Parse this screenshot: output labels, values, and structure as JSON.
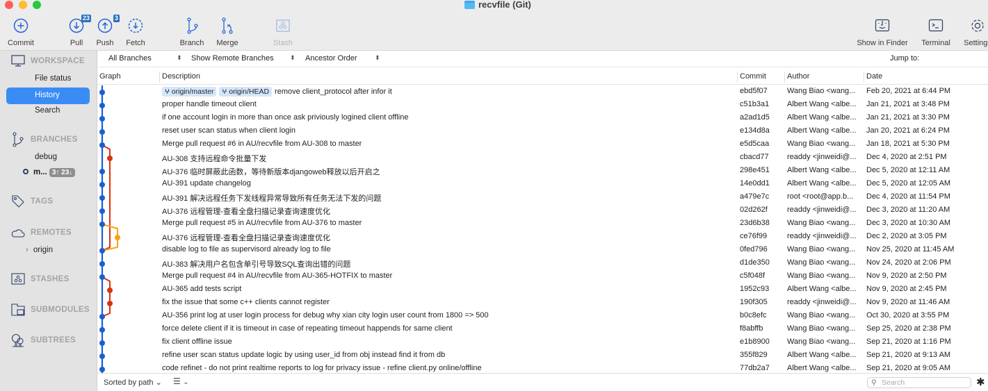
{
  "window": {
    "title": "recvfile (Git)"
  },
  "toolbar": {
    "commit": "Commit",
    "pull": "Pull",
    "pull_badge": "23",
    "push": "Push",
    "push_badge": "3",
    "fetch": "Fetch",
    "branch": "Branch",
    "merge": "Merge",
    "stash": "Stash",
    "show_in_finder": "Show in Finder",
    "terminal": "Terminal",
    "settings": "Settings"
  },
  "sidebar": {
    "workspace": "WORKSPACE",
    "file_status": "File status",
    "history": "History",
    "search": "Search",
    "branches": "BRANCHES",
    "branch_debug": "debug",
    "branch_current": "m...",
    "branch_current_badge": "3↑ 23↓",
    "tags": "TAGS",
    "remotes": "REMOTES",
    "remote_origin": "origin",
    "stashes": "STASHES",
    "submodules": "SUBMODULES",
    "subtrees": "SUBTREES"
  },
  "filters": {
    "branches": "All Branches",
    "remote": "Show Remote Branches",
    "order": "Ancestor Order",
    "jump_to": "Jump to:"
  },
  "columns": {
    "graph": "Graph",
    "description": "Description",
    "commit": "Commit",
    "author": "Author",
    "date": "Date"
  },
  "colors": {
    "main_line": "#1a5fd0",
    "branch_red": "#d9330f",
    "branch_orange": "#f5a318",
    "accent": "#3a8cf5"
  },
  "commits": [
    {
      "tags": [
        "origin/master",
        "origin/HEAD"
      ],
      "desc": "remove client_protocol after infor it",
      "hash": "ebd5f07",
      "author": "Wang Biao <wang...",
      "date": "Feb 20, 2021 at 6:44 PM"
    },
    {
      "tags": [],
      "desc": "proper handle timeout client",
      "hash": "c51b3a1",
      "author": "Albert Wang <albe...",
      "date": "Jan 21, 2021 at 3:48 PM"
    },
    {
      "tags": [],
      "desc": "if one account login in more than once ask priviously logined client offline",
      "hash": "a2ad1d5",
      "author": "Albert Wang <albe...",
      "date": "Jan 21, 2021 at 3:30 PM"
    },
    {
      "tags": [],
      "desc": "reset user scan status when client login",
      "hash": "e134d8a",
      "author": "Albert Wang <albe...",
      "date": "Jan 20, 2021 at 6:24 PM"
    },
    {
      "tags": [],
      "desc": "Merge pull request #6 in AU/recvfile from AU-308 to master",
      "hash": "e5d5caa",
      "author": "Wang Biao <wang...",
      "date": "Jan 18, 2021 at 5:30 PM"
    },
    {
      "tags": [],
      "desc": "AU-308 支持远程命令批量下发",
      "hash": "cbacd77",
      "author": "readdy <jinweidi@...",
      "date": "Dec 4, 2020 at 2:51 PM"
    },
    {
      "tags": [],
      "desc": "AU-376 临时屏蔽此函数，等待新版本djangoweb释放以后开启之",
      "hash": "298e451",
      "author": "Albert Wang <albe...",
      "date": "Dec 5, 2020 at 12:11 AM"
    },
    {
      "tags": [],
      "desc": "AU-391 update changelog",
      "hash": "14e0dd1",
      "author": "Albert Wang <albe...",
      "date": "Dec 5, 2020 at 12:05 AM"
    },
    {
      "tags": [],
      "desc": "AU-391 解决远程任务下发线程异常导致所有任务无法下发的问题",
      "hash": "a479e7c",
      "author": "root <root@app.b...",
      "date": "Dec 4, 2020 at 11:54 PM"
    },
    {
      "tags": [],
      "desc": "AU-376 远程管理-查看全盘扫描记录查询速度优化",
      "hash": "02d262f",
      "author": "readdy <jinweidi@...",
      "date": "Dec 3, 2020 at 11:20 AM"
    },
    {
      "tags": [],
      "desc": "Merge pull request #5 in AU/recvfile from AU-376 to master",
      "hash": "23d6b38",
      "author": "Wang Biao <wang...",
      "date": "Dec 3, 2020 at 10:30 AM"
    },
    {
      "tags": [],
      "desc": "AU-376 远程管理-查看全盘扫描记录查询速度优化",
      "hash": "ce76f99",
      "author": "readdy <jinweidi@...",
      "date": "Dec 2, 2020 at 3:05 PM"
    },
    {
      "tags": [],
      "desc": "disable log to file as supervisord already log to file",
      "hash": "0fed796",
      "author": "Wang Biao <wang...",
      "date": "Nov 25, 2020 at 11:45 AM"
    },
    {
      "tags": [],
      "desc": "AU-383 解决用户名包含单引号导致SQL查询出错的问题",
      "hash": "d1de350",
      "author": "Wang Biao <wang...",
      "date": "Nov 24, 2020 at 2:06 PM"
    },
    {
      "tags": [],
      "desc": "Merge pull request #4 in AU/recvfile from AU-365-HOTFIX to master",
      "hash": "c5f048f",
      "author": "Wang Biao <wang...",
      "date": "Nov 9, 2020 at 2:50 PM"
    },
    {
      "tags": [],
      "desc": "AU-365 add tests script",
      "hash": "1952c93",
      "author": "Albert Wang <albe...",
      "date": "Nov 9, 2020 at 2:45 PM"
    },
    {
      "tags": [],
      "desc": "fix the issue that some c++ clients cannot register",
      "hash": "190f305",
      "author": "readdy <jinweidi@...",
      "date": "Nov 9, 2020 at 11:46 AM"
    },
    {
      "tags": [],
      "desc": "AU-356 print log at user login process for debug why xian city login user count from 1800 => 500",
      "hash": "b0c8efc",
      "author": "Wang Biao <wang...",
      "date": "Oct 30, 2020 at 3:55 PM"
    },
    {
      "tags": [],
      "desc": "force delete client if it is timeout in case of repeating timeout happends for same client",
      "hash": "f8abffb",
      "author": "Wang Biao <wang...",
      "date": "Sep 25, 2020 at 2:38 PM"
    },
    {
      "tags": [],
      "desc": "fix client offline issue",
      "hash": "e1b8900",
      "author": "Wang Biao <wang...",
      "date": "Sep 21, 2020 at 1:16 PM"
    },
    {
      "tags": [],
      "desc": "refine user scan status update logic by using user_id from obj instead find it from db",
      "hash": "355f829",
      "author": "Albert Wang <albe...",
      "date": "Sep 21, 2020 at 9:13 AM"
    },
    {
      "tags": [],
      "desc": "code refinet - do not print realtime reports to log for privacy issue - refine client.py online/offline",
      "hash": "77db2a7",
      "author": "Albert Wang <albe...",
      "date": "Sep 21, 2020 at 9:05 AM"
    }
  ],
  "graph": {
    "main_lane_rows": [
      0,
      1,
      2,
      3,
      4,
      6,
      7,
      8,
      9,
      10,
      12,
      13,
      14,
      17,
      18,
      19,
      20,
      21
    ],
    "branches": [
      {
        "color": "branch_red",
        "lane": 1,
        "from_row": 4,
        "to_row": 12,
        "dot_rows": [
          5
        ]
      },
      {
        "color": "branch_orange",
        "lane": 2,
        "from_row": 10,
        "to_row": 12,
        "dot_rows": [
          11
        ]
      },
      {
        "color": "branch_red",
        "lane": 1,
        "from_row": 14,
        "to_row": 17,
        "dot_rows": [
          15,
          16
        ]
      }
    ]
  },
  "bottom": {
    "sort": "Sorted by path",
    "search_placeholder": "Search"
  }
}
